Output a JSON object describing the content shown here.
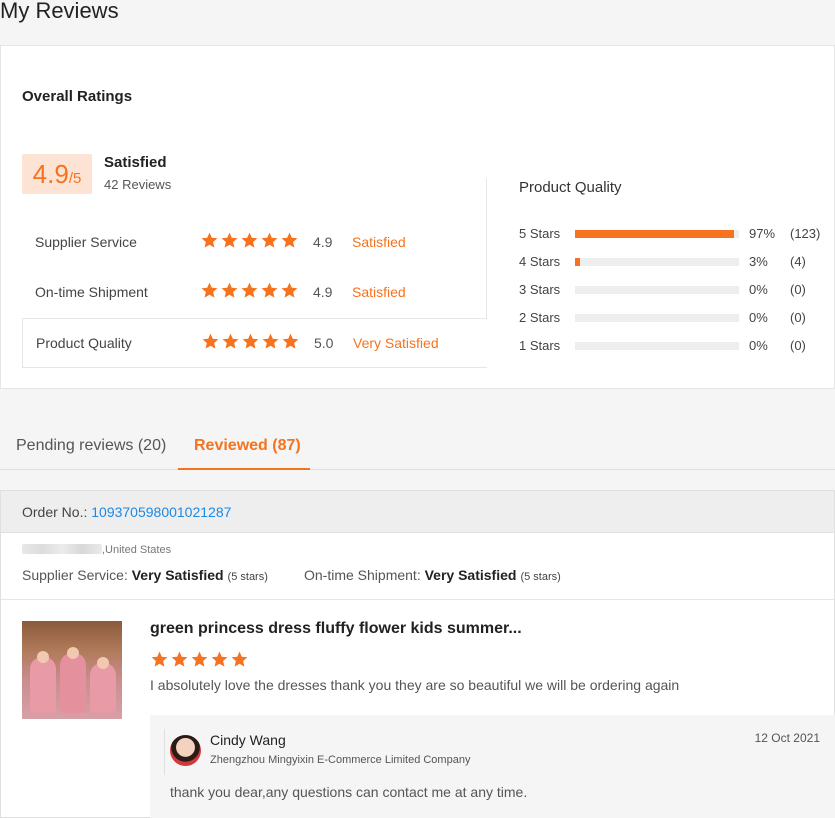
{
  "page_title": "My Reviews",
  "overall": {
    "title": "Overall Ratings",
    "score": "4.9",
    "score_den": "/5",
    "satisfied_label": "Satisfied",
    "reviews_count": "42 Reviews",
    "rows": [
      {
        "name": "Supplier Service",
        "stars": 5,
        "score": "4.9",
        "text": "Satisfied"
      },
      {
        "name": "On-time Shipment",
        "stars": 5,
        "score": "4.9",
        "text": "Satisfied"
      },
      {
        "name": "Product Quality",
        "stars": 5,
        "score": "5.0",
        "text": "Very Satisfied"
      }
    ]
  },
  "product_quality": {
    "title": "Product Quality",
    "bars": [
      {
        "label": "5  Stars",
        "pct": "97%",
        "count": "(123)",
        "fill": 0.97
      },
      {
        "label": "4  Stars",
        "pct": "3%",
        "count": "(4)",
        "fill": 0.03
      },
      {
        "label": "3  Stars",
        "pct": "0%",
        "count": "(0)",
        "fill": 0
      },
      {
        "label": "2  Stars",
        "pct": "0%",
        "count": "(0)",
        "fill": 0
      },
      {
        "label": "1  Stars",
        "pct": "0%",
        "count": "(0)",
        "fill": 0
      }
    ]
  },
  "tabs": [
    {
      "label": "Pending reviews (20)",
      "active": false
    },
    {
      "label": "Reviewed (87)",
      "active": true
    }
  ],
  "order": {
    "label": "Order No.: ",
    "number": "109370598001021287",
    "buyer_country": ",United States",
    "supplier_service_label": "Supplier Service: ",
    "supplier_service_value": "Very Satisfied",
    "supplier_service_stars": "(5 stars)",
    "shipment_label": "On-time Shipment: ",
    "shipment_value": "Very Satisfied",
    "shipment_stars": "(5 stars)"
  },
  "review": {
    "product_title": "green princess dress fluffy flower kids summer...",
    "stars": 5,
    "text": "I absolutely love the dresses thank you they are so beautiful we will be ordering again",
    "reply": {
      "name": "Cindy Wang",
      "company": "Zhengzhou Mingyixin E-Commerce Limited Company",
      "date": "12 Oct 2021",
      "text": "thank you dear,any questions can contact me at any time."
    }
  },
  "colors": {
    "accent": "#f5731f",
    "link": "#1e88e5",
    "badge_bg": "#fde3d3"
  },
  "icons": {
    "star": "star-icon"
  }
}
